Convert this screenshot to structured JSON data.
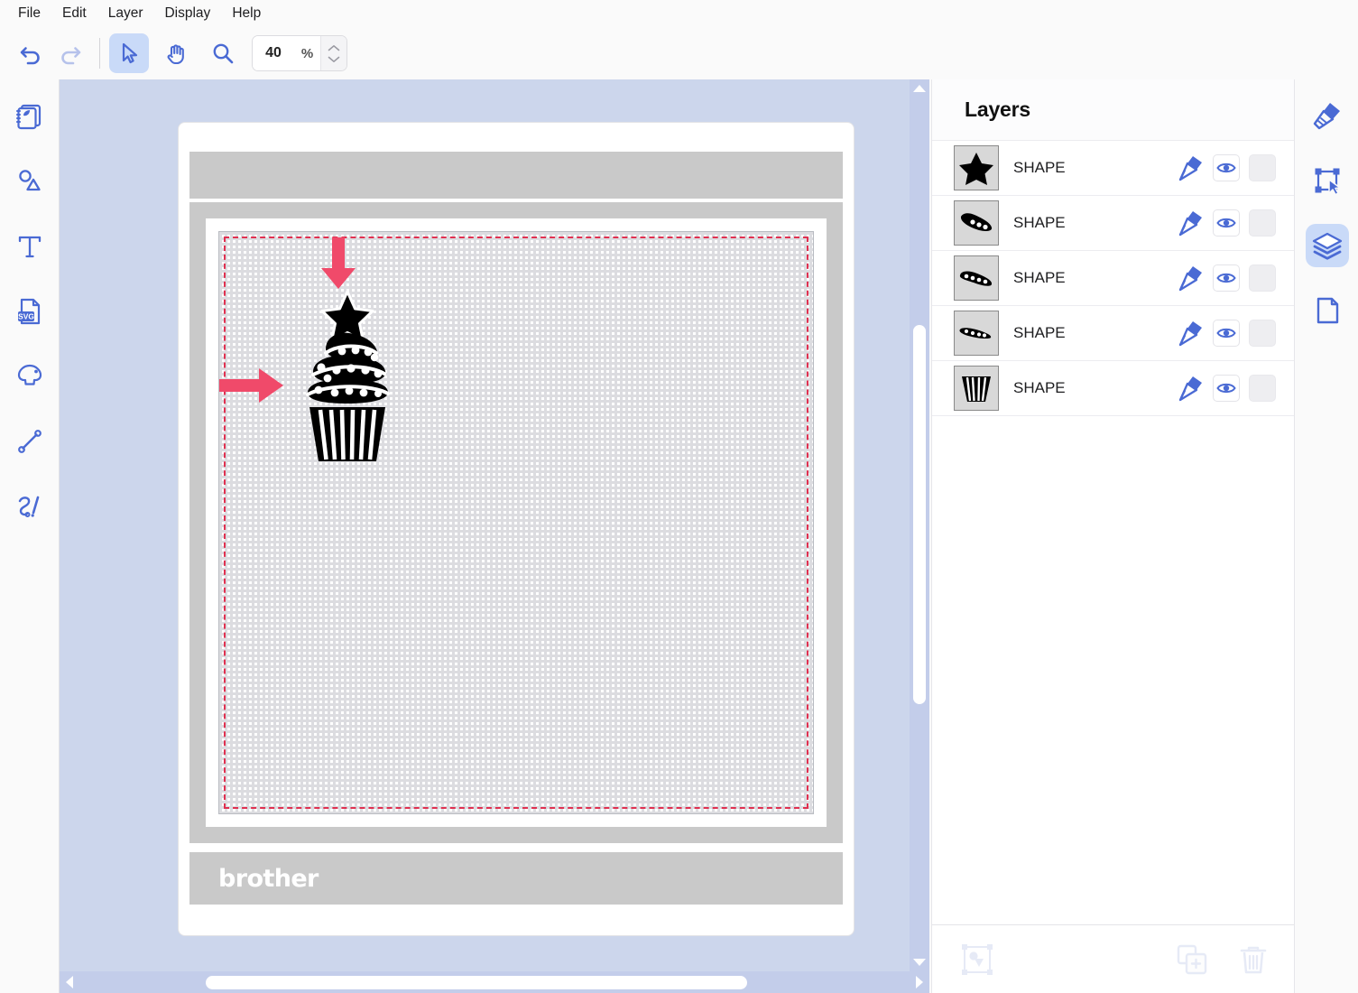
{
  "app": {
    "accent": "#4a6ad4",
    "arrow_color": "#f04a6a",
    "canvas_bg": "#ccd6ec",
    "mat_gray": "#c9c9c9",
    "cut_line_color": "#e03050"
  },
  "menubar": {
    "items": [
      {
        "label": "File",
        "name": "menu-file"
      },
      {
        "label": "Edit",
        "name": "menu-edit"
      },
      {
        "label": "Layer",
        "name": "menu-layer"
      },
      {
        "label": "Display",
        "name": "menu-display"
      },
      {
        "label": "Help",
        "name": "menu-help"
      }
    ]
  },
  "toolbar": {
    "undo": {
      "icon": "undo-icon",
      "enabled": true
    },
    "redo": {
      "icon": "redo-icon",
      "enabled": false
    },
    "select": {
      "icon": "select-arrow-icon",
      "active": true
    },
    "pan": {
      "icon": "hand-pan-icon",
      "active": false
    },
    "zoom_tool": {
      "icon": "magnifier-icon",
      "active": false
    },
    "zoom": {
      "value": "40",
      "unit": "%",
      "placeholder": "100",
      "spin_up": "chevron-up-icon",
      "spin_down": "chevron-down-icon"
    }
  },
  "left_rail": {
    "items": [
      {
        "name": "pattern-library-icon",
        "label": "Pattern"
      },
      {
        "name": "basic-shapes-icon",
        "label": "Shapes"
      },
      {
        "name": "text-tool-icon",
        "label": "Text"
      },
      {
        "name": "svg-import-icon",
        "label": "SVG"
      },
      {
        "name": "trace-image-icon",
        "label": "Trace"
      },
      {
        "name": "line-tool-icon",
        "label": "Line"
      },
      {
        "name": "freehand-draw-icon",
        "label": "Draw"
      }
    ]
  },
  "right_rail": {
    "items": [
      {
        "name": "properties-brush-icon",
        "label": "Properties",
        "active": false
      },
      {
        "name": "transform-select-icon",
        "label": "Transform",
        "active": false
      },
      {
        "name": "layers-stack-icon",
        "label": "Layers",
        "active": true
      },
      {
        "name": "page-document-icon",
        "label": "Page",
        "active": false
      }
    ]
  },
  "layers_panel": {
    "title": "Layers",
    "rows": [
      {
        "label": "SHAPE",
        "thumb": "star-shape-thumb",
        "visible": true
      },
      {
        "label": "SHAPE",
        "thumb": "frosting-swirl-top-thumb",
        "visible": true
      },
      {
        "label": "SHAPE",
        "thumb": "frosting-swirl-mid-thumb",
        "visible": true
      },
      {
        "label": "SHAPE",
        "thumb": "frosting-swirl-low-thumb",
        "visible": true
      },
      {
        "label": "SHAPE",
        "thumb": "cupcake-base-thumb",
        "visible": true
      }
    ],
    "row_action_icons": {
      "edit": "pencil-edit-icon",
      "visibility": "eye-visible-icon",
      "extra": "blank-toggle-box"
    },
    "footer": {
      "group": {
        "name": "group-shapes-icon",
        "enabled": false
      },
      "duplicate": {
        "name": "duplicate-layer-icon",
        "enabled": true
      },
      "delete": {
        "name": "delete-layer-trash-icon",
        "enabled": true
      }
    }
  },
  "canvas": {
    "mat_brand": "brother",
    "artwork": {
      "name": "cupcake-artwork"
    },
    "annotations": [
      {
        "name": "annotation-arrow-down",
        "direction": "down"
      },
      {
        "name": "annotation-arrow-right",
        "direction": "right"
      }
    ]
  },
  "scrollbars": {
    "vertical": {
      "up": "scroll-up-arrow",
      "down": "scroll-down-arrow"
    },
    "horizontal": {
      "left": "scroll-left-arrow",
      "right": "scroll-right-arrow"
    }
  }
}
